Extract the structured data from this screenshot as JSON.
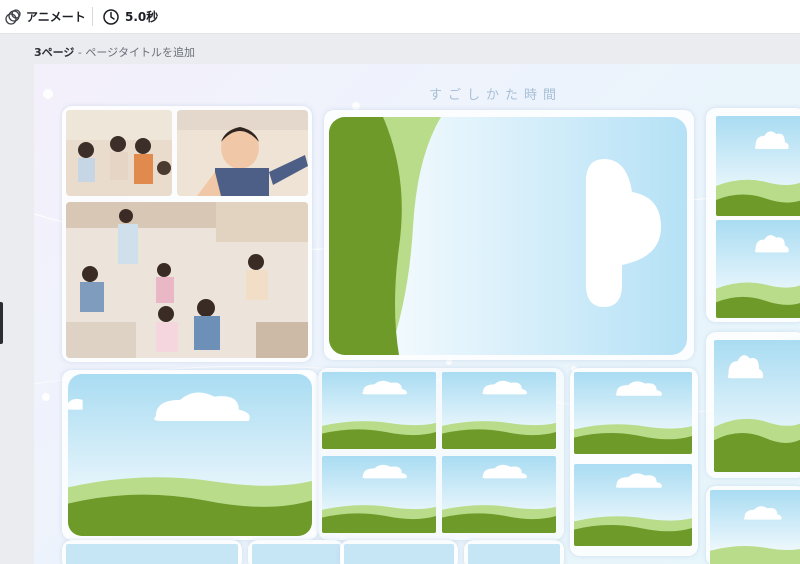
{
  "toolbar": {
    "animate_label": "アニメート",
    "duration_label": "5.0秒",
    "animate_icon": "animation-icon",
    "duration_icon": "clock-icon"
  },
  "page": {
    "number_label": "3ページ",
    "separator": " - ",
    "title_placeholder": "ページタイトルを追加"
  },
  "canvas": {
    "title": "すごしかた時間",
    "colors": {
      "sky_top": "#a9dcf2",
      "sky_bottom": "#ffffff",
      "hill_dark": "#6e9a2a",
      "hill_light": "#b9dc8a",
      "cloud": "#ffffff",
      "frame": "#ffffff"
    }
  }
}
